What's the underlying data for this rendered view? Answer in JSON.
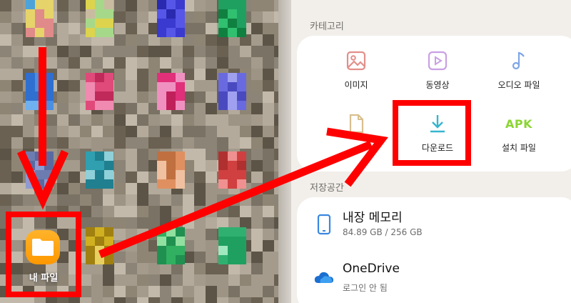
{
  "home_screen": {
    "files_app_label": "내 파일"
  },
  "my_files": {
    "categories_title": "카테고리",
    "categories": [
      {
        "name": "image",
        "label": "이미지",
        "icon": "image-icon",
        "color": "#e28f8b"
      },
      {
        "name": "video",
        "label": "동영상",
        "icon": "play-icon",
        "color": "#c9a0e4"
      },
      {
        "name": "audio",
        "label": "오디오 파일",
        "icon": "music-note-icon",
        "color": "#7ea6e6"
      },
      {
        "name": "document",
        "label": "",
        "icon": "document-icon",
        "color": "#d8bf8f"
      },
      {
        "name": "downloads",
        "label": "다운로드",
        "icon": "download-icon",
        "color": "#36b5cf"
      },
      {
        "name": "apk",
        "label": "설치 파일",
        "icon": "apk-icon",
        "icon_text": "APK",
        "color": "#8bd534"
      }
    ],
    "storage_title": "저장공간",
    "storage": [
      {
        "name": "internal",
        "title": "내장 메모리",
        "subtitle": "84.89 GB / 256 GB",
        "icon": "phone-icon",
        "color": "#3b87e0"
      },
      {
        "name": "onedrive",
        "title": "OneDrive",
        "subtitle": "로그인 안 됨",
        "icon": "cloud-icon",
        "color": "#1b6fd0"
      }
    ]
  },
  "annotations": {
    "highlight_color": "#ff0000"
  }
}
